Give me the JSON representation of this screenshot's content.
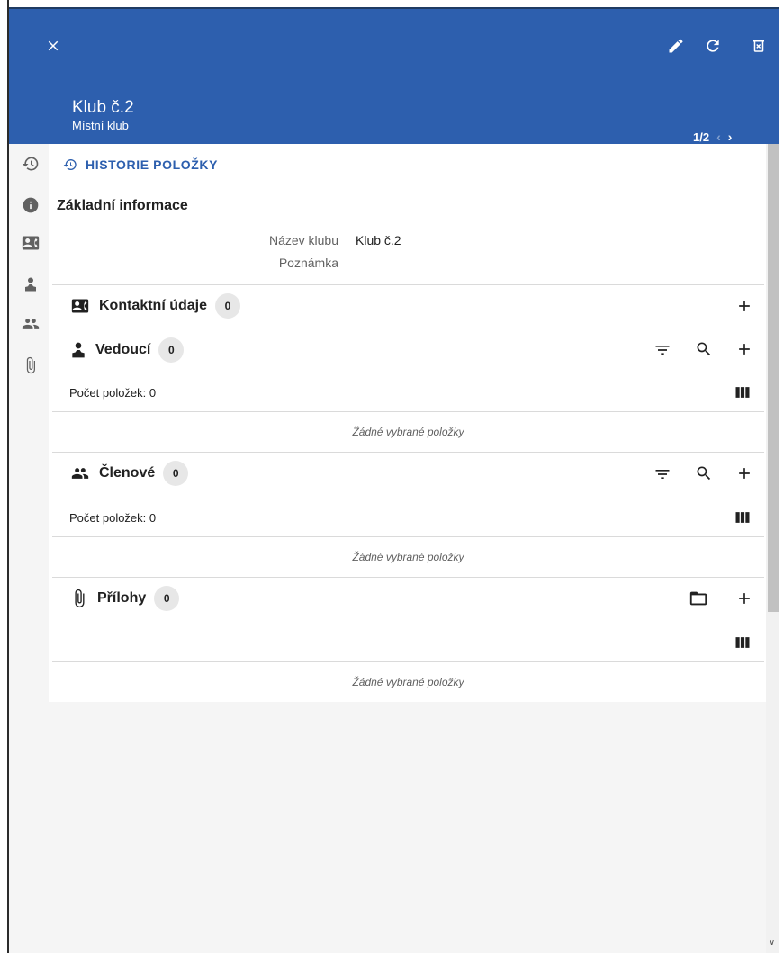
{
  "header": {
    "title": "Klub č.2",
    "subtitle": "Místní klub",
    "pager": {
      "current": "1",
      "separator": "/",
      "total": "2"
    }
  },
  "history": {
    "label": "HISTORIE POLOŽKY"
  },
  "basic_info": {
    "heading": "Základní informace",
    "fields": [
      {
        "label": "Název klubu",
        "value": "Klub č.2"
      },
      {
        "label": "Poznámka",
        "value": ""
      }
    ]
  },
  "sections": {
    "contacts": {
      "title": "Kontaktní údaje",
      "count": "0"
    },
    "leaders": {
      "title": "Vedoucí",
      "count": "0",
      "items_count": "Počet položek: 0",
      "empty": "Žádné vybrané položky"
    },
    "members": {
      "title": "Členové",
      "count": "0",
      "items_count": "Počet položek: 0",
      "empty": "Žádné vybrané položky"
    },
    "attachments": {
      "title": "Přílohy",
      "count": "0",
      "empty": "Žádné vybrané položky"
    }
  },
  "colors": {
    "header_bg": "#2d5fae",
    "accent": "#2d5fae",
    "background": "#f5f5f5"
  },
  "icons": [
    "close-icon",
    "edit-icon",
    "refresh-icon",
    "delete-icon",
    "history-icon",
    "info-icon",
    "contact-card-icon",
    "person-icon",
    "people-icon",
    "paperclip-icon",
    "filter-icon",
    "search-icon",
    "add-icon",
    "columns-icon",
    "folder-icon"
  ]
}
